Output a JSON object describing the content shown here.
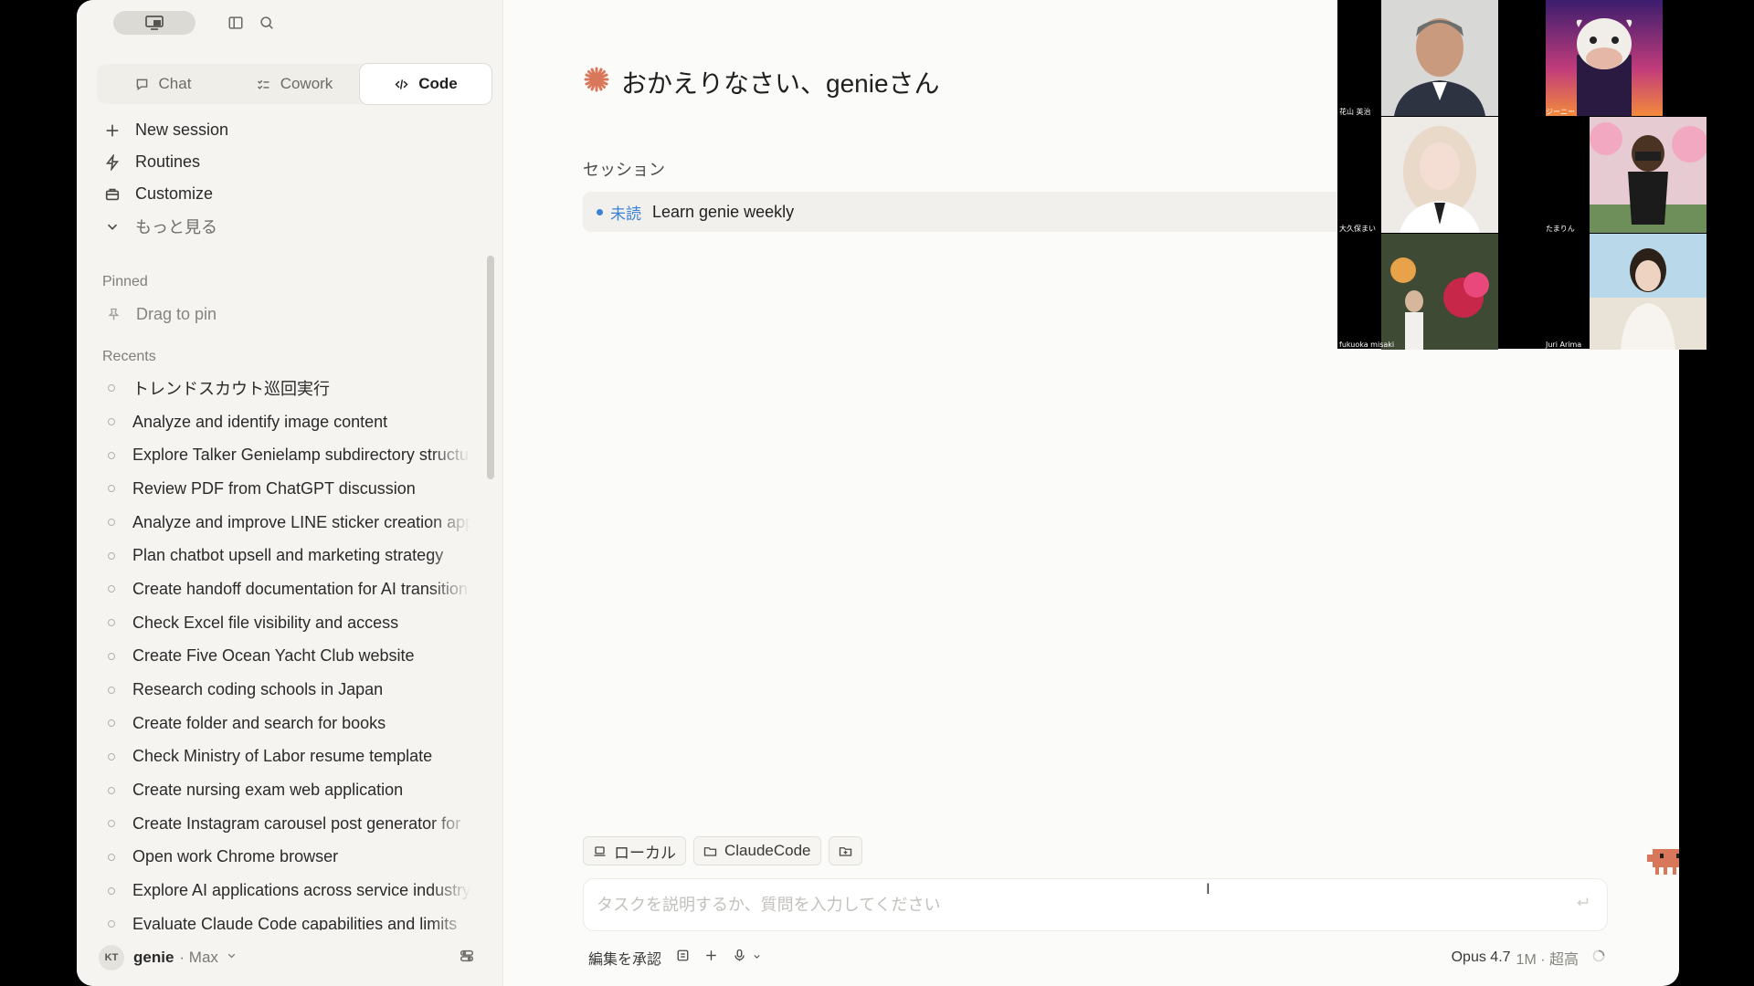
{
  "sidebar": {
    "tabs": [
      {
        "label": "Chat",
        "icon": "chat-icon",
        "active": false
      },
      {
        "label": "Cowork",
        "icon": "cowork-icon",
        "active": false
      },
      {
        "label": "Code",
        "icon": "code-icon",
        "active": true
      }
    ],
    "menu": [
      {
        "label": "New session",
        "icon": "plus-icon"
      },
      {
        "label": "Routines",
        "icon": "bolt-icon"
      },
      {
        "label": "Customize",
        "icon": "briefcase-icon"
      },
      {
        "label": "もっと見る",
        "icon": "chevron-down-icon"
      }
    ],
    "pinned_label": "Pinned",
    "pin_hint": "Drag to pin",
    "recents_label": "Recents",
    "recents": [
      "トレンドスカウト巡回実行",
      "Analyze and identify image content",
      "Explore Talker Genielamp subdirectory structure",
      "Review PDF from ChatGPT discussion",
      "Analyze and improve LINE sticker creation app",
      "Plan chatbot upsell and marketing strategy",
      "Create handoff documentation for AI transition",
      "Check Excel file visibility and access",
      "Create Five Ocean Yacht Club website",
      "Research coding schools in Japan",
      "Create folder and search for books",
      "Check Ministry of Labor resume template",
      "Create nursing exam web application",
      "Create Instagram carousel post generator for",
      "Open work Chrome browser",
      "Explore AI applications across service industry",
      "Evaluate Claude Code capabilities and limits"
    ],
    "user": {
      "initials": "KT",
      "name": "genie",
      "plan": "· Max"
    }
  },
  "main": {
    "welcome": "おかえりなさい、genieさん",
    "sessions_label": "セッション",
    "session": {
      "badge": "未読",
      "title": "Learn genie weekly"
    },
    "chips": [
      {
        "label": "ローカル",
        "icon": "laptop-icon"
      },
      {
        "label": "ClaudeCode",
        "icon": "folder-icon"
      }
    ],
    "input_placeholder": "タスクを説明するか、質問を入力してください",
    "accept_edits": "編集を承認",
    "model": "Opus 4.7",
    "context": "1M · 超高"
  },
  "video": {
    "participants": [
      "花山 英治",
      "ジーニー",
      "大久保まい",
      "たまりん",
      "fukuoka misaki",
      "Juri Arima"
    ]
  },
  "colors": {
    "accent_orange": "#d9775a",
    "unread_blue": "#3b82d6",
    "sidebar_bg": "#f5f4f1",
    "main_bg": "#fbfbfa"
  }
}
